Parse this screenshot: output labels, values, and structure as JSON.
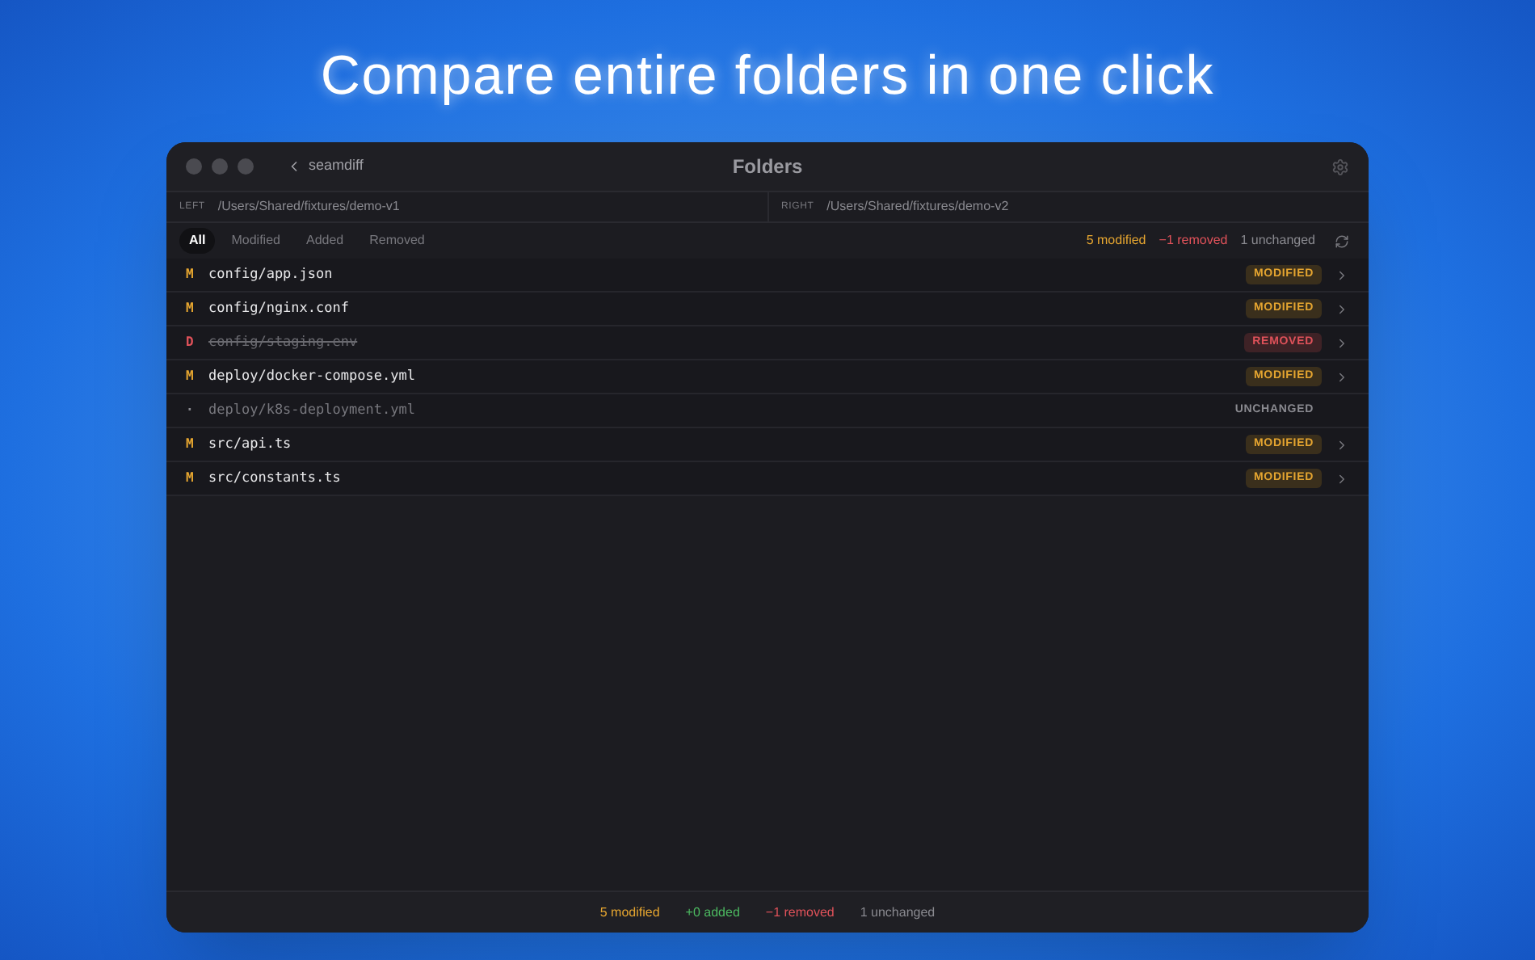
{
  "headline": "Compare entire folders in one click",
  "window": {
    "title": "Folders",
    "back_label": "seamdiff"
  },
  "paths": {
    "left_label": "LEFT",
    "left": "/Users/Shared/fixtures/demo-v1",
    "right_label": "RIGHT",
    "right": "/Users/Shared/fixtures/demo-v2"
  },
  "filters": [
    {
      "label": "All",
      "selected": true
    },
    {
      "label": "Modified",
      "selected": false
    },
    {
      "label": "Added",
      "selected": false
    },
    {
      "label": "Removed",
      "selected": false
    }
  ],
  "summary": [
    {
      "text": "5 modified",
      "kind": "modified"
    },
    {
      "text": "−1 removed",
      "kind": "removed"
    },
    {
      "text": "1 unchanged",
      "kind": "unchanged"
    }
  ],
  "files": [
    {
      "letter": "M",
      "path": "config/app.json",
      "status": "MODIFIED",
      "kind": "modified"
    },
    {
      "letter": "M",
      "path": "config/nginx.conf",
      "status": "MODIFIED",
      "kind": "modified"
    },
    {
      "letter": "D",
      "path": "config/staging.env",
      "status": "REMOVED",
      "kind": "removed"
    },
    {
      "letter": "M",
      "path": "deploy/docker-compose.yml",
      "status": "MODIFIED",
      "kind": "modified"
    },
    {
      "letter": "·",
      "path": "deploy/k8s-deployment.yml",
      "status": "UNCHANGED",
      "kind": "unchanged"
    },
    {
      "letter": "M",
      "path": "src/api.ts",
      "status": "MODIFIED",
      "kind": "modified"
    },
    {
      "letter": "M",
      "path": "src/constants.ts",
      "status": "MODIFIED",
      "kind": "modified"
    }
  ],
  "footer": [
    {
      "text": "5 modified",
      "kind": "modified"
    },
    {
      "text": "+0 added",
      "kind": "added"
    },
    {
      "text": "−1 removed",
      "kind": "removed"
    },
    {
      "text": "1 unchanged",
      "kind": "unchanged"
    }
  ]
}
